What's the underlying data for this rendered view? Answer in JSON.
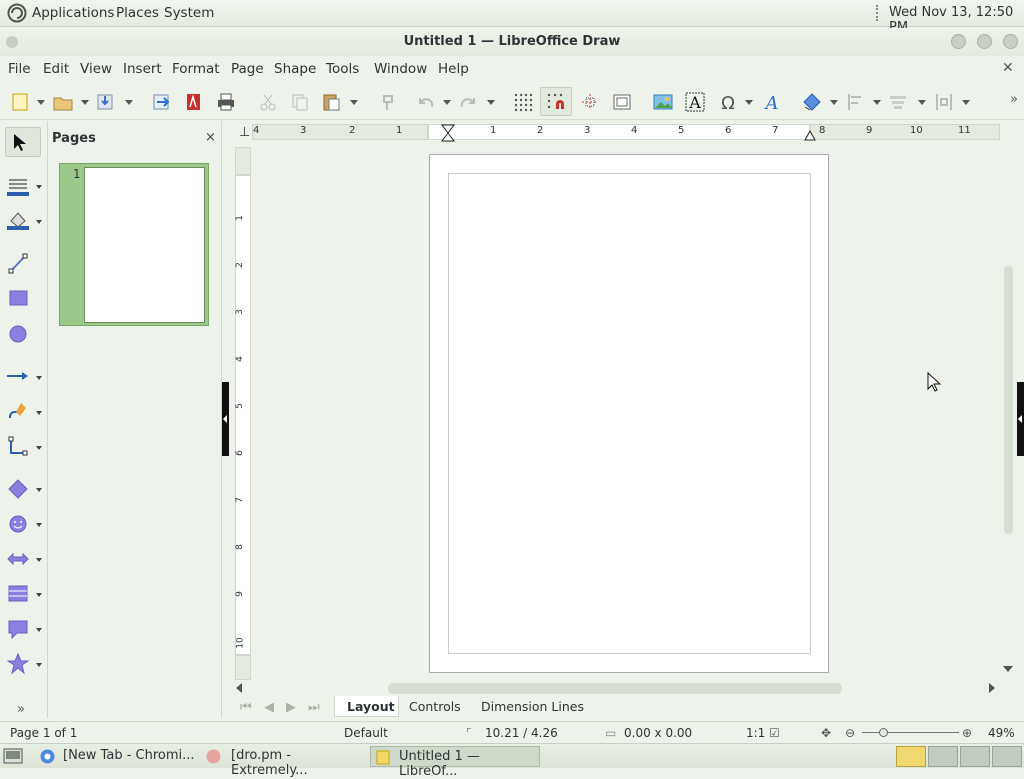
{
  "topbar": {
    "apps": "Applications",
    "places": "Places",
    "system": "System",
    "clock": "Wed Nov 13, 12:50 PM"
  },
  "window": {
    "title": "Untitled 1 — LibreOffice Draw"
  },
  "menubar": {
    "items": [
      "File",
      "Edit",
      "View",
      "Insert",
      "Format",
      "Page",
      "Shape",
      "Tools",
      "Window",
      "Help"
    ]
  },
  "pages_panel": {
    "title": "Pages",
    "close": "×",
    "thumb_number": "1"
  },
  "hruler_labels": [
    "4",
    "3",
    "2",
    "1",
    "1",
    "2",
    "3",
    "4",
    "5",
    "6",
    "7",
    "8",
    "9",
    "10",
    "11"
  ],
  "vruler_labels": [
    "1",
    "2",
    "3",
    "4",
    "5",
    "6",
    "7",
    "8",
    "9",
    "10"
  ],
  "tabs": {
    "items": [
      "Layout",
      "Controls",
      "Dimension Lines"
    ],
    "active": "Layout"
  },
  "statusbar": {
    "page": "Page 1 of 1",
    "master": "Default",
    "position": "10.21 / 4.26",
    "size": "0.00 x 0.00",
    "scale": "1:1",
    "zoom": "49%"
  },
  "taskbar": {
    "items": [
      "[New Tab - Chromi...",
      "[dro.pm - Extremely...",
      "Untitled 1 — LibreOf..."
    ]
  },
  "colors": {
    "bg": "#edf3ea",
    "page_thumb_bg": "#9cc98a",
    "accent": "#2a6fd6"
  }
}
